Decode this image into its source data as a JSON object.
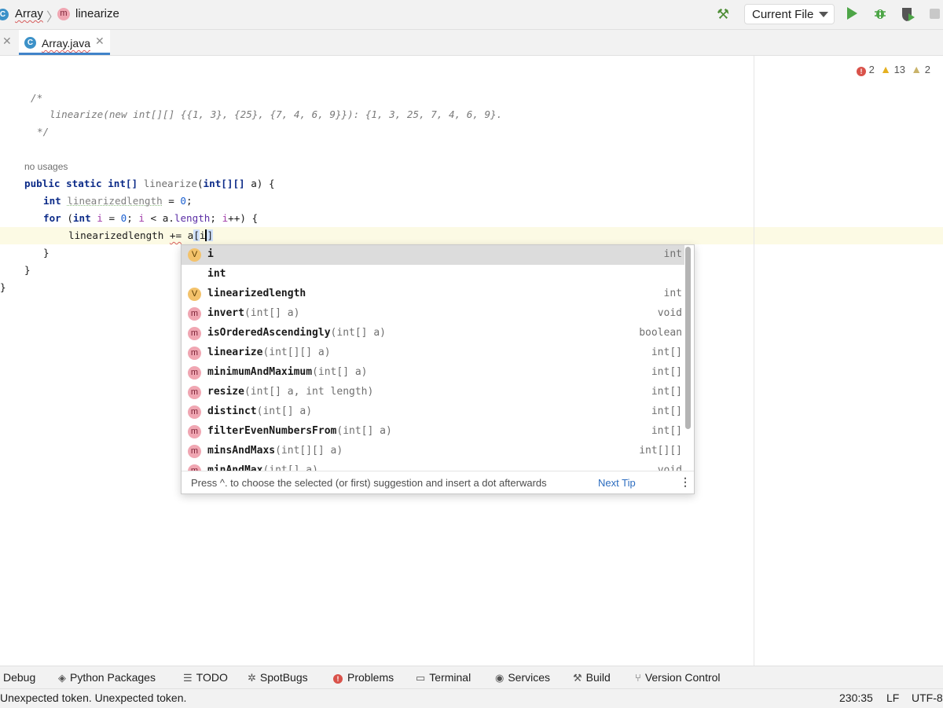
{
  "navbar": {
    "crumb_class": "Array",
    "crumb_method": "linearize",
    "run_config": "Current File"
  },
  "tab": {
    "label": "Array.java"
  },
  "inspections": {
    "errors": "2",
    "warnings": "13",
    "weak_warnings": "2"
  },
  "editor": {
    "comment_open": "/*",
    "comment_body": "linearize(new int[][] {{1, 3}, {25}, {7, 4, 6, 9}}): {1, 3, 25, 7, 4, 6, 9}.",
    "comment_close": "*/",
    "usage_hint": "no usages",
    "method_signature": {
      "public": "public",
      "static": "static",
      "ret": "int[]",
      "name": "linearize",
      "param_type": "int[][]",
      "rest": " a) {"
    },
    "line_decl": {
      "kw": "int",
      "var": "linearizedlength",
      "rest": " = ",
      "num": "0",
      "end": ";"
    },
    "line_for": {
      "kw": "for",
      "open": " (",
      "int": "int",
      "i1": "i",
      "eq": " = ",
      "zero": "0",
      "semi": "; ",
      "i2": "i",
      "lt": " < a.",
      "length": "length",
      "semi2": "; ",
      "i3": "i",
      "rest": "++) {"
    },
    "line_current": {
      "lhs": "linearizedlength ",
      "op": "+=",
      "mid": " a",
      "bracket_open": "[",
      "typed": "i",
      "bracket_close": "]"
    },
    "close_inner": "}",
    "close_method": "}",
    "close_class": "}"
  },
  "completion": {
    "items": [
      {
        "icon": "V",
        "kind": "variable",
        "match": "i",
        "name": "",
        "params": "",
        "type": "int",
        "selected": true
      },
      {
        "icon": "",
        "kind": "keyword",
        "match": "i",
        "name": "nt",
        "params": "",
        "type": ""
      },
      {
        "icon": "V",
        "kind": "variable",
        "match": "l",
        "name": "inearizedlength",
        "params": "",
        "type": "int"
      },
      {
        "icon": "m",
        "kind": "method",
        "match": "invert",
        "name": "",
        "params": "(int[] a)",
        "type": "void"
      },
      {
        "icon": "m",
        "kind": "method",
        "match": "isOrderedAscendingly",
        "name": "",
        "params": "(int[] a)",
        "type": "boolean"
      },
      {
        "icon": "m",
        "kind": "method",
        "match": "linearize",
        "name": "",
        "params": "(int[][] a)",
        "type": "int[]"
      },
      {
        "icon": "m",
        "kind": "method",
        "match": "minimumAndMaximum",
        "name": "",
        "params": "(int[] a)",
        "type": "int[]"
      },
      {
        "icon": "m",
        "kind": "method",
        "match": "resize",
        "name": "",
        "params": "(int[] a, int length)",
        "type": "int[]"
      },
      {
        "icon": "m",
        "kind": "method",
        "match": "distinct",
        "name": "",
        "params": "(int[] a)",
        "type": "int[]"
      },
      {
        "icon": "m",
        "kind": "method",
        "match": "filterEvenNumbersFrom",
        "name": "",
        "params": "(int[] a)",
        "type": "int[]"
      },
      {
        "icon": "m",
        "kind": "method",
        "match": "minsAndMaxs",
        "name": "",
        "params": "(int[][] a)",
        "type": "int[][]"
      },
      {
        "icon": "m",
        "kind": "method",
        "match": "minAndMax",
        "name": "",
        "params": "(int[] a)",
        "type": "void"
      }
    ],
    "footer_text": "Press ^. to choose the selected (or first) suggestion and insert a dot afterwards",
    "footer_link": "Next Tip"
  },
  "tool_windows": [
    {
      "label": "Debug",
      "icon": ""
    },
    {
      "label": "Python Packages",
      "icon": "layers-icon"
    },
    {
      "label": "TODO",
      "icon": "list-icon"
    },
    {
      "label": "SpotBugs",
      "icon": "bug-icon"
    },
    {
      "label": "Problems",
      "icon": "error-icon"
    },
    {
      "label": "Terminal",
      "icon": "terminal-icon"
    },
    {
      "label": "Services",
      "icon": "services-icon"
    },
    {
      "label": "Build",
      "icon": "hammer-icon"
    },
    {
      "label": "Version Control",
      "icon": "branch-icon"
    }
  ],
  "status": {
    "message": "Unexpected token. Unexpected token.",
    "position": "230:35",
    "line_separator": "LF",
    "encoding": "UTF-8"
  },
  "colors": {
    "accent": "#4083c9",
    "run": "#4da547",
    "error": "#d9524a",
    "method_icon": "#f0a6b2",
    "var_icon": "#f3c26b"
  }
}
